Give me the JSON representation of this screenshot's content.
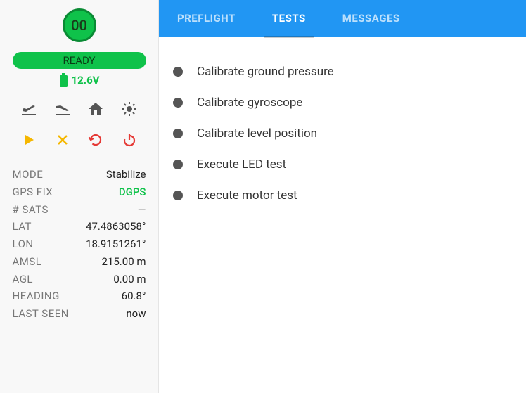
{
  "sidebar": {
    "drone_id": "00",
    "status": "READY",
    "voltage": "12.6V",
    "colors": {
      "accent": "#0fc24a"
    }
  },
  "telemetry": {
    "mode": {
      "label": "MODE",
      "value": "Stabilize"
    },
    "gpsfix": {
      "label": "GPS FIX",
      "value": "DGPS"
    },
    "sats": {
      "label": "# SATS",
      "value": "—"
    },
    "lat": {
      "label": "LAT",
      "value": "47.4863058°"
    },
    "lon": {
      "label": "LON",
      "value": "18.9151261°"
    },
    "amsl": {
      "label": "AMSL",
      "value": "215.00 m"
    },
    "agl": {
      "label": "AGL",
      "value": "0.00 m"
    },
    "heading": {
      "label": "HEADING",
      "value": "60.8°"
    },
    "lastseen": {
      "label": "LAST SEEN",
      "value": "now"
    }
  },
  "tabs": {
    "preflight": "PREFLIGHT",
    "tests": "TESTS",
    "messages": "MESSAGES"
  },
  "tests": [
    "Calibrate ground pressure",
    "Calibrate gyroscope",
    "Calibrate level position",
    "Execute LED test",
    "Execute motor test"
  ]
}
